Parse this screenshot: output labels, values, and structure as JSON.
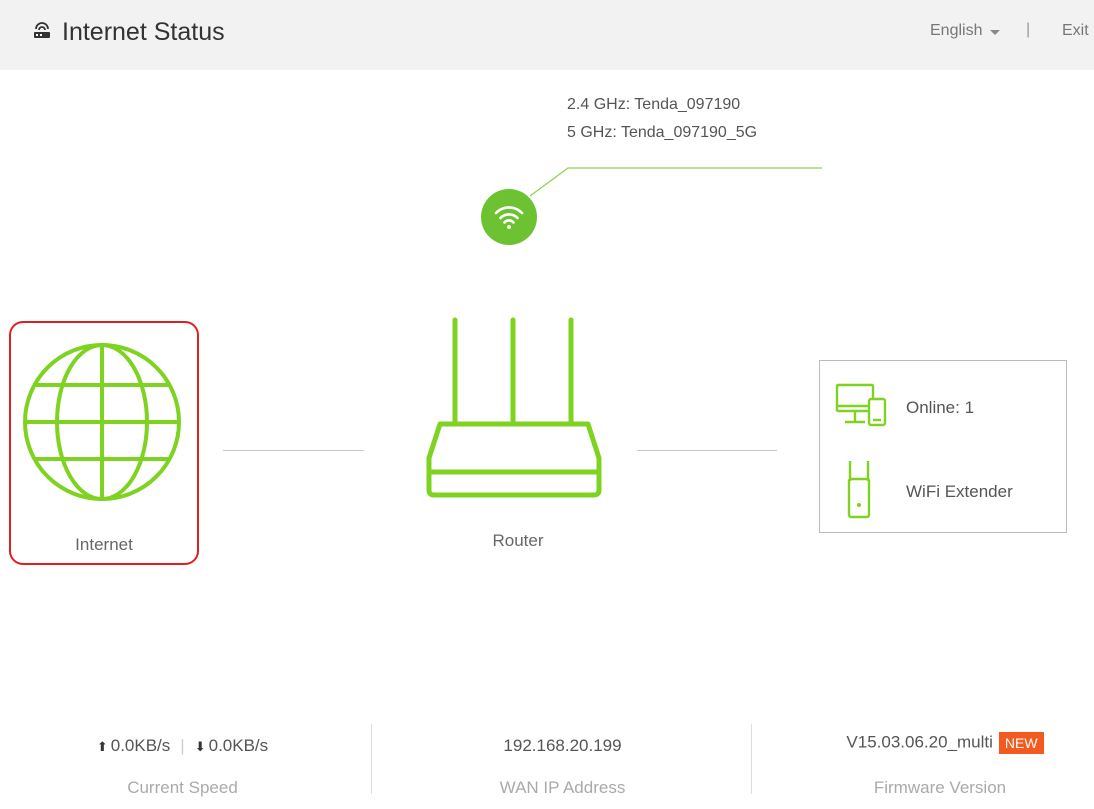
{
  "header": {
    "title": "Internet Status",
    "title_icon": "router-icon",
    "language": "English",
    "separator": "|",
    "exit_label": "Exit",
    "background": "#f2f2f2"
  },
  "wifi": {
    "ssid_24": "2.4 GHz: Tenda_097190",
    "ssid_5": "5 GHz: Tenda_097190_5G",
    "icon": "wifi-icon",
    "color": "#6cc230"
  },
  "topology": {
    "internet_label": "Internet",
    "internet_icon": "globe-icon",
    "router_label": "Router",
    "router_icon": "router-icon",
    "accent": "#7ed321",
    "highlight": "#e02020"
  },
  "devices": {
    "online_label": "Online:  1",
    "online_icon": "devices-icon",
    "extender_label": "WiFi Extender",
    "extender_icon": "extender-icon"
  },
  "stats": {
    "upload_speed": "0.0KB/s",
    "download_speed": "0.0KB/s",
    "speed_separator": "|",
    "speed_label": "Current Speed",
    "wan_ip": "192.168.20.199",
    "wan_label": "WAN IP Address",
    "firmware_version": "V15.03.06.20_multi",
    "firmware_badge": "NEW",
    "firmware_label": "Firmware Version",
    "badge_color": "#f25a1f"
  }
}
